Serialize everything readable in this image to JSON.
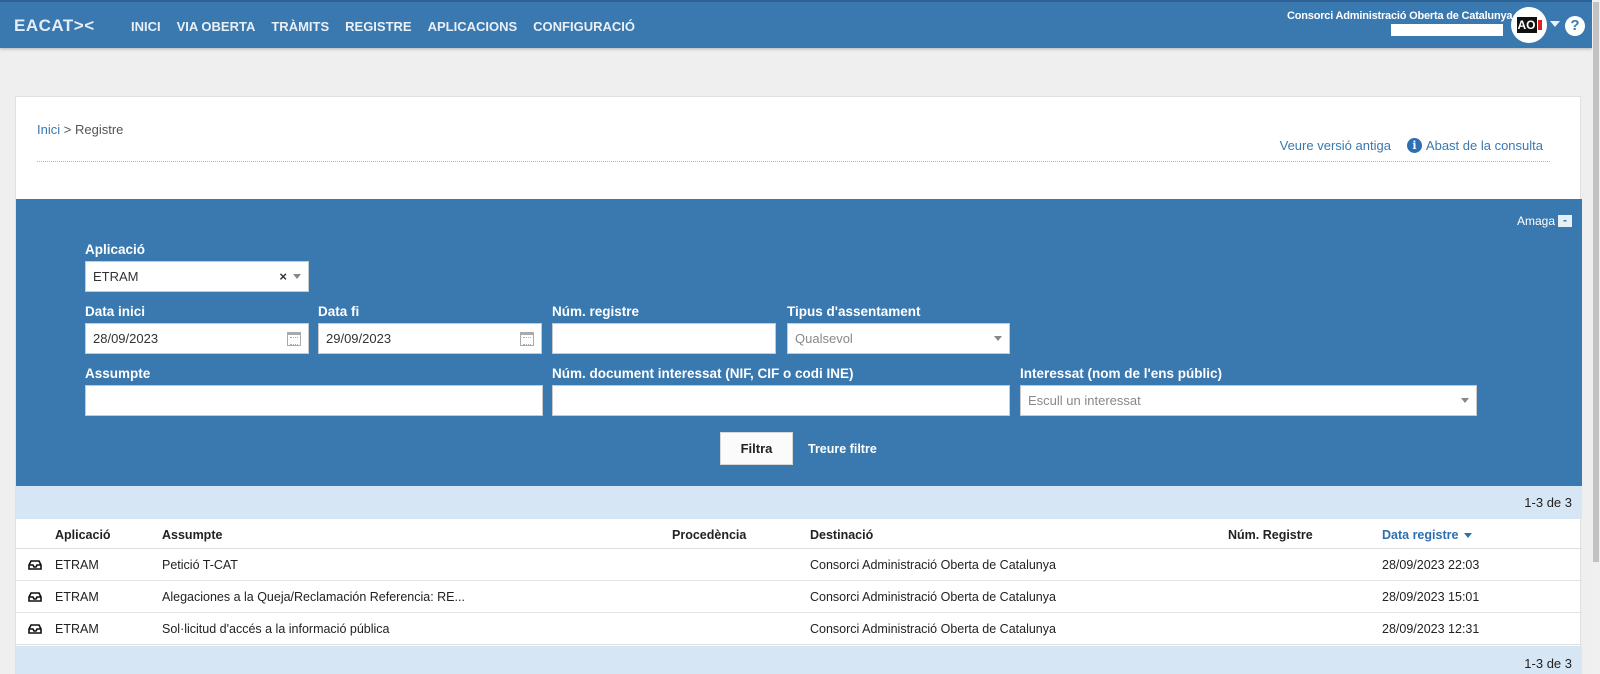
{
  "header": {
    "logo": "EACAT><",
    "nav": [
      "INICI",
      "VIA OBERTA",
      "TRÀMITS",
      "REGISTRE",
      "APLICACIONS",
      "CONFIGURACIÓ"
    ],
    "org_name": "Consorci Administració Oberta de Catalunya",
    "aoc_logo": "AOC",
    "help": "?"
  },
  "breadcrumb": {
    "home": "Inici",
    "separator": ">",
    "current": "Registre"
  },
  "top_links": {
    "old_version": "Veure versió antiga",
    "scope": "Abast de la consulta"
  },
  "filter": {
    "hide_label": "Amaga",
    "application": {
      "label": "Aplicació",
      "value": "ETRAM",
      "clear": "×"
    },
    "start_date": {
      "label": "Data inici",
      "value": "28/09/2023"
    },
    "end_date": {
      "label": "Data fi",
      "value": "29/09/2023"
    },
    "registry_number": {
      "label": "Núm. registre",
      "value": ""
    },
    "entry_type": {
      "label": "Tipus d'assentament",
      "value": "Qualsevol"
    },
    "subject": {
      "label": "Assumpte",
      "value": ""
    },
    "doc_number": {
      "label": "Núm. document interessat (NIF, CIF o codi INE)",
      "value": ""
    },
    "interested": {
      "label": "Interessat (nom de l'ens públic)",
      "placeholder": "Escull un interessat"
    },
    "submit": "Filtra",
    "clear": "Treure filtre"
  },
  "results": {
    "count": "1-3 de 3",
    "bottom_count": "1-3 de 3",
    "columns": [
      "Aplicació",
      "Assumpte",
      "Procedència",
      "Destinació",
      "Núm. Registre",
      "Data registre"
    ],
    "rows": [
      {
        "app": "ETRAM",
        "subject": "Petició T-CAT",
        "origin": "",
        "destination": "Consorci Administració Oberta de Catalunya",
        "number": "",
        "date": "28/09/2023 22:03"
      },
      {
        "app": "ETRAM",
        "subject": "Alegaciones a la Queja/Reclamación Referencia: RE...",
        "origin": "",
        "destination": "Consorci Administració Oberta de Catalunya",
        "number": "",
        "date": "28/09/2023 15:01"
      },
      {
        "app": "ETRAM",
        "subject": "Sol·licitud d'accés a la informació pública",
        "origin": "",
        "destination": "Consorci Administració Oberta de Catalunya",
        "number": "",
        "date": "28/09/2023 12:31"
      }
    ]
  },
  "colors": {
    "brand": "#3a78b0",
    "link": "#2d6fb3",
    "result_bar": "#d6e6f4"
  }
}
